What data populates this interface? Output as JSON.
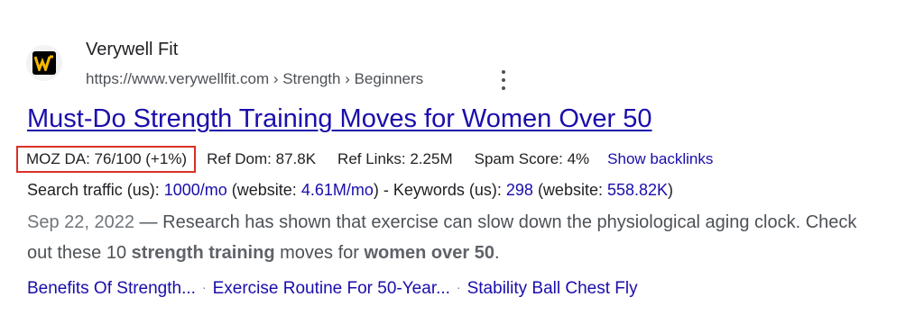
{
  "site": {
    "name": "Verywell Fit",
    "favicon_letter": "W",
    "url": "https://www.verywellfit.com › Strength › Beginners"
  },
  "result": {
    "title": "Must-Do Strength Training Moves for Women Over 50"
  },
  "mozbar": {
    "moz_da": "MOZ DA: 76/100 (+1%)",
    "ref_dom": "Ref Dom: 87.8K",
    "ref_links": "Ref Links: 2.25M",
    "spam_score": "Spam Score: 4%",
    "show_backlinks": "Show backlinks"
  },
  "traffic": {
    "search_label": "Search traffic (us): ",
    "search_value": "1000/mo",
    "website_label_1": " (website: ",
    "website_value_1": "4.61M/mo",
    "keywords_label": ") - Keywords (us): ",
    "keywords_value": "298",
    "website_label_2": " (website: ",
    "website_value_2": "558.82K",
    "close": ")"
  },
  "snippet": {
    "date": "Sep 22, 2022",
    "dash": " — ",
    "text_1": "Research has shown that exercise can slow down the physiological aging clock. Check out these 10 ",
    "bold_1": "strength training",
    "text_2": " moves for ",
    "bold_2": "women over 50",
    "text_3": "."
  },
  "sitelinks": [
    "Benefits Of Strength...",
    "Exercise Routine For 50-Year...",
    "Stability Ball Chest Fly"
  ],
  "separator": "·",
  "colors": {
    "link": "#1a0dab",
    "moz_box_border": "#d93025",
    "favicon_accent": "#f5b800"
  }
}
